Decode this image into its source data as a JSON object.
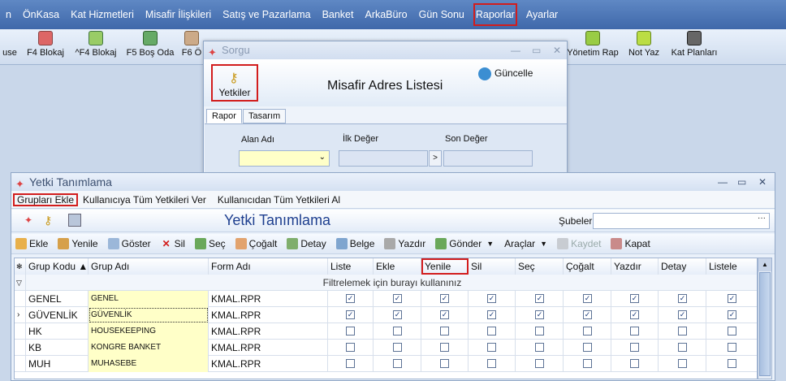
{
  "menubar": {
    "items": [
      "n",
      "ÖnKasa",
      "Kat Hizmetleri",
      "Misafir İlişkileri",
      "Satış ve Pazarlama",
      "Banket",
      "ArkaBüro",
      "Gün Sonu",
      "Raporlar",
      "Ayarlar"
    ]
  },
  "toolbar": {
    "buttons": [
      "use",
      "F4 Blokaj",
      "^F4 Blokaj",
      "F5 Boş Oda",
      "F6 Ö",
      "Yönetim Rap",
      "Not Yaz",
      "Kat Planları"
    ]
  },
  "sorgu": {
    "title": "Sorgu",
    "yetkiler_label": "Yetkiler",
    "heading": "Misafir Adres Listesi",
    "guncelle_label": "Güncelle",
    "tabs": [
      "Rapor",
      "Tasarım"
    ],
    "alan_adi_label": "Alan Adı",
    "ilk_deger_label": "İlk Değer",
    "son_deger_label": "Son Değer",
    "arrow_label": ">"
  },
  "yetki": {
    "title": "Yetki Tanımlama",
    "menu": [
      "Grupları Ekle",
      "Kullanıcıya Tüm Yetkileri Ver",
      "Kullanıcıdan Tüm Yetkileri Al"
    ],
    "heading": "Yetki Tanımlama",
    "subeler_label": "Şubeler",
    "toolbar": [
      "Ekle",
      "Yenile",
      "Göster",
      "Sil",
      "Seç",
      "Çoğalt",
      "Detay",
      "Belge",
      "Yazdır",
      "Gönder",
      "Araçlar",
      "Kaydet",
      "Kapat"
    ],
    "grid": {
      "columns": [
        "Grup Kodu ▲",
        "Grup Adı",
        "Form Adı",
        "Liste",
        "Ekle",
        "Yenile",
        "Sil",
        "Seç",
        "Çoğalt",
        "Yazdır",
        "Detay",
        "Listele"
      ],
      "filter_text": "Filtrelemek için burayı kullanınız",
      "rows": [
        {
          "kod": "GENEL",
          "ad": "GENEL",
          "form": "KMAL.RPR",
          "checks": [
            1,
            1,
            1,
            1,
            1,
            1,
            1,
            1,
            1
          ]
        },
        {
          "kod": "GÜVENLİK",
          "ad": "GÜVENLİK",
          "form": "KMAL.RPR",
          "checks": [
            1,
            1,
            1,
            1,
            1,
            1,
            1,
            1,
            1
          ]
        },
        {
          "kod": "HK",
          "ad": "HOUSEKEEPING",
          "form": "KMAL.RPR",
          "checks": [
            0,
            0,
            0,
            0,
            0,
            0,
            0,
            0,
            0
          ]
        },
        {
          "kod": "KB",
          "ad": "KONGRE BANKET",
          "form": "KMAL.RPR",
          "checks": [
            0,
            0,
            0,
            0,
            0,
            0,
            0,
            0,
            0
          ]
        },
        {
          "kod": "MUH",
          "ad": "MUHASEBE",
          "form": "KMAL.RPR",
          "checks": [
            0,
            0,
            0,
            0,
            0,
            0,
            0,
            0,
            0
          ]
        }
      ]
    }
  },
  "colors": {
    "menubar": "#4a74b6",
    "highlight": "#d21d1d",
    "heading_blue": "#1e3f8f",
    "yellow_cell": "#ffffc8"
  }
}
